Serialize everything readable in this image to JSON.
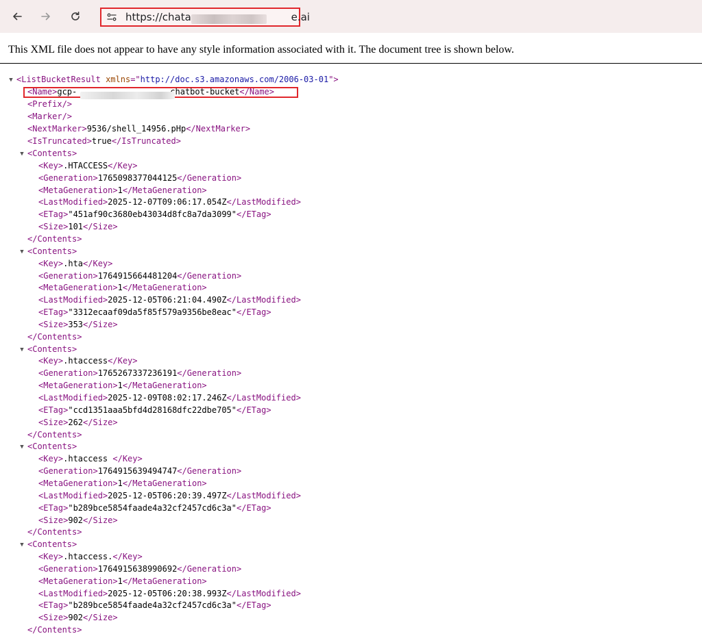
{
  "browser": {
    "url_prefix": "https://chatas",
    "url_suffix": "e.ai"
  },
  "viewer": {
    "notice": "This XML file does not appear to have any style information associated with it. The document tree is shown below.",
    "collapse_glyph": "▼"
  },
  "xml": {
    "root_tag": "ListBucketResult",
    "xmlns_attr": "xmlns",
    "xmlns_value": "http://doc.s3.amazonaws.com/2006-03-01",
    "name_prefix": "gcp-",
    "name_suffix": "chatbot-bucket",
    "prefix_tag": "<Prefix/>",
    "marker_tag": "<Marker/>",
    "next_marker": "9536/shell_14956.pHp",
    "is_truncated": "true",
    "contents": [
      {
        "key": ".HTACCESS",
        "generation": "1765098377044125",
        "metageneration": "1",
        "last_modified": "2025-12-07T09:06:17.054Z",
        "etag": "\"451af90c3680eb43034d8fc8a7da3099\"",
        "size": "101"
      },
      {
        "key": ".hta",
        "generation": "1764915664481204",
        "metageneration": "1",
        "last_modified": "2025-12-05T06:21:04.490Z",
        "etag": "\"3312ecaaf09da5f85f579a9356be8eac\"",
        "size": "353"
      },
      {
        "key": ".htaccess",
        "generation": "1765267337236191",
        "metageneration": "1",
        "last_modified": "2025-12-09T08:02:17.246Z",
        "etag": "\"ccd1351aaa5bfd4d28168dfc22dbe705\"",
        "size": "262"
      },
      {
        "key": ".htaccess ",
        "generation": "1764915639494747",
        "metageneration": "1",
        "last_modified": "2025-12-05T06:20:39.497Z",
        "etag": "\"b289bce5854faade4a32cf2457cd6c3a\"",
        "size": "902"
      },
      {
        "key": ".htaccess.",
        "generation": "1764915638990692",
        "metageneration": "1",
        "last_modified": "2025-12-05T06:20:38.993Z",
        "etag": "\"b289bce5854faade4a32cf2457cd6c3a\"",
        "size": "902"
      }
    ]
  },
  "colors": {
    "toolbar_bg": "#f5eded",
    "highlight_box": "#e0262b",
    "tag": "#881280",
    "attr_name": "#994500",
    "attr_value": "#1a1aa6"
  }
}
